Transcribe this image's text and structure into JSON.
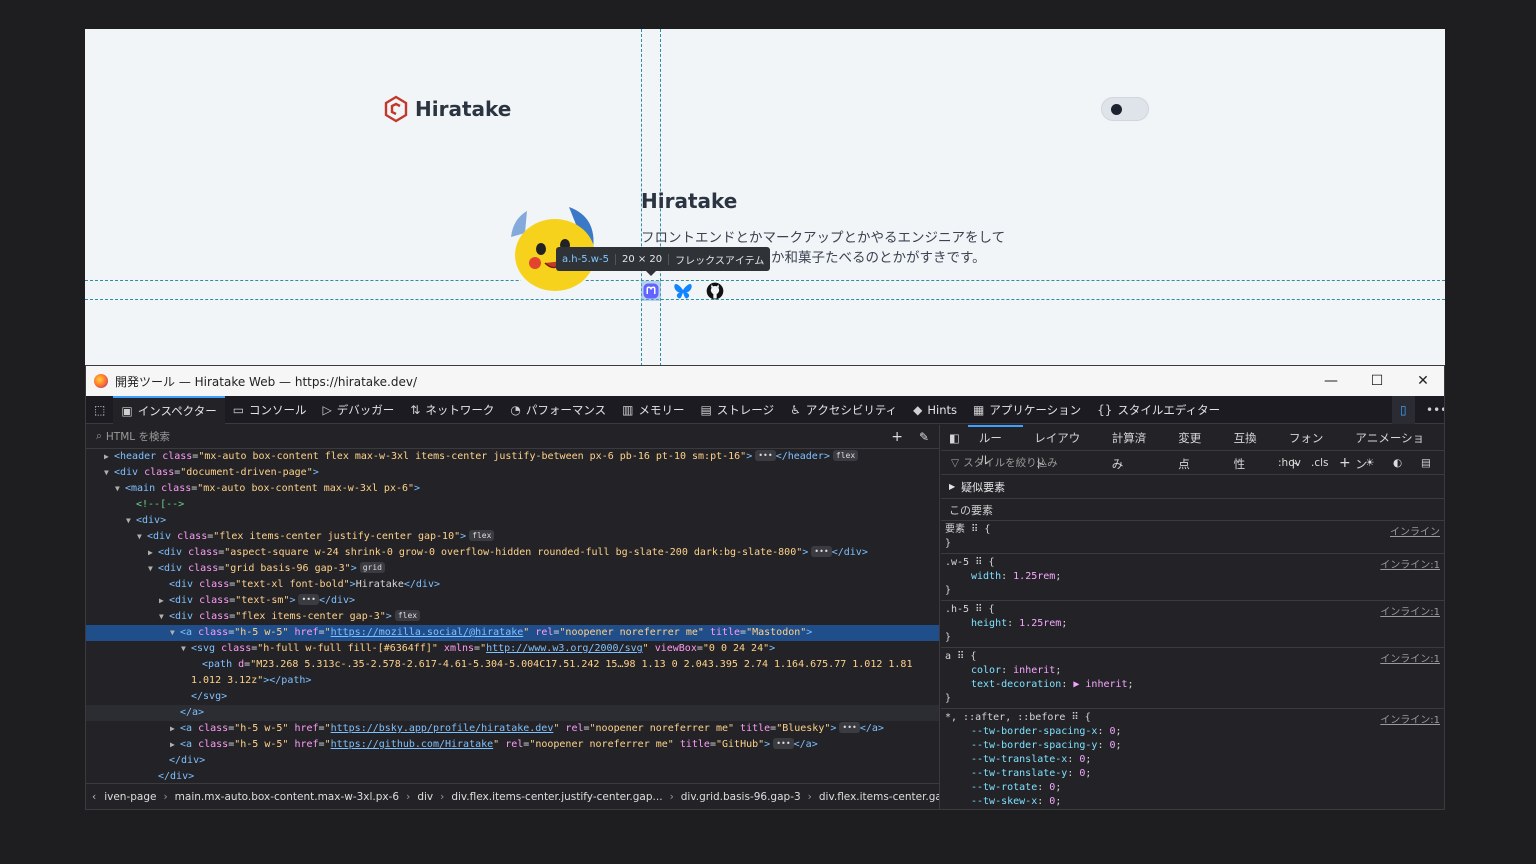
{
  "site": {
    "logo_text": "Hiratake",
    "profile_name": "Hiratake",
    "desc_line1": "フロントエンドとかマークアップとかやるエンジニアをして",
    "desc_line2": "か和菓子たべるのとかがすきです。",
    "mastodon_title": "Mastodon",
    "bluesky_title": "Bluesky",
    "github_title": "GitHub"
  },
  "tooltip": {
    "selector": "a.h-5.w-5",
    "size": "20 × 20",
    "kind": "フレックスアイテム"
  },
  "window": {
    "title": "開発ツール — Hiratake Web — https://hiratake.dev/",
    "minimize": "—",
    "maximize": "☐",
    "close": "✕"
  },
  "tabs": [
    "インスペクター",
    "コンソール",
    "デバッガー",
    "ネットワーク",
    "パフォーマンス",
    "メモリー",
    "ストレージ",
    "アクセシビリティ",
    "Hints",
    "アプリケーション",
    "スタイルエディター"
  ],
  "html_search_placeholder": "HTML を検索",
  "tree": [
    {
      "d": 2,
      "t": "▶",
      "h": "<span class='tg'>&lt;header</span> <span class='at'>class</span>=<span class='av'>\"mx-auto box-content flex max-w-3xl items-center justify-between px-6 pb-16 pt-10 sm:pt-16\"</span><span class='tg'>&gt;</span><span class='badge'>•••</span><span class='tg'>&lt;/header&gt;</span><span class='badge'>flex</span>"
    },
    {
      "d": 2,
      "t": "▼",
      "h": "<span class='tg'>&lt;div</span> <span class='at'>class</span>=<span class='av'>\"document-driven-page\"</span><span class='tg'>&gt;</span>"
    },
    {
      "d": 3,
      "t": "▼",
      "h": "<span class='tg'>&lt;main</span> <span class='at'>class</span>=<span class='av'>\"mx-auto box-content max-w-3xl px-6\"</span><span class='tg'>&gt;</span>"
    },
    {
      "d": 4,
      "t": "",
      "h": "<span class='cm'>&lt;!--[--&gt;</span>"
    },
    {
      "d": 4,
      "t": "▼",
      "h": "<span class='tg'>&lt;div&gt;</span>"
    },
    {
      "d": 5,
      "t": "▼",
      "h": "<span class='tg'>&lt;div</span> <span class='at'>class</span>=<span class='av'>\"flex items-center justify-center gap-10\"</span><span class='tg'>&gt;</span><span class='badge'>flex</span>"
    },
    {
      "d": 6,
      "t": "▶",
      "h": "<span class='tg'>&lt;div</span> <span class='at'>class</span>=<span class='av'>\"aspect-square w-24 shrink-0 grow-0 overflow-hidden rounded-full bg-slate-200 dark:bg-slate-800\"</span><span class='tg'>&gt;</span><span class='badge'>•••</span><span class='tg'>&lt;/div&gt;</span>"
    },
    {
      "d": 6,
      "t": "▼",
      "h": "<span class='tg'>&lt;div</span> <span class='at'>class</span>=<span class='av'>\"grid basis-96 gap-3\"</span><span class='tg'>&gt;</span><span class='badge'>grid</span>"
    },
    {
      "d": 7,
      "t": "",
      "h": "<span class='tg'>&lt;div</span> <span class='at'>class</span>=<span class='av'>\"text-xl font-bold\"</span><span class='tg'>&gt;</span>Hiratake<span class='tg'>&lt;/div&gt;</span>"
    },
    {
      "d": 7,
      "t": "▶",
      "h": "<span class='tg'>&lt;div</span> <span class='at'>class</span>=<span class='av'>\"text-sm\"</span><span class='tg'>&gt;</span><span class='badge'>•••</span><span class='tg'>&lt;/div&gt;</span>"
    },
    {
      "d": 7,
      "t": "▼",
      "h": "<span class='tg'>&lt;div</span> <span class='at'>class</span>=<span class='av'>\"flex items-center gap-3\"</span><span class='tg'>&gt;</span><span class='badge'>flex</span>"
    },
    {
      "d": 8,
      "t": "▼",
      "sel": true,
      "h": "<span class='tg'>&lt;a</span> <span class='at'>class</span>=<span class='av'>\"h-5 w-5\"</span> <span class='at'>href</span>=<span class='av'>\"<span class='lk'>https://mozilla.social/@hiratake</span>\"</span> <span class='at'>rel</span>=<span class='av'>\"noopener noreferrer me\"</span> <span class='at'>title</span>=<span class='av'>\"Mastodon\"</span><span class='tg'>&gt;</span>"
    },
    {
      "d": 9,
      "t": "▼",
      "h": "<span class='tg'>&lt;svg</span> <span class='at'>class</span>=<span class='av'>\"h-full w-full fill-[#6364ff]\"</span> <span class='at'>xmlns</span>=<span class='av'>\"<span class='lk'>http://www.w3.org/2000/svg</span>\"</span> <span class='at'>viewBox</span>=<span class='av'>\"0 0 24 24\"</span><span class='tg'>&gt;</span>"
    },
    {
      "d": 10,
      "t": "",
      "h": "<span class='tg'>&lt;path</span> <span class='at'>d</span>=<span class='av'>\"M23.268 5.313c-.35-2.578-2.617-4.61-5.304-5.004C17.51.242 15…98 1.13 0 2.043.395 2.74 1.164.675.77 1.012 1.81</span>"
    },
    {
      "d": 9,
      "t": "",
      "h": "<span class='av'>1.012 3.12z\"</span><span class='tg'>&gt;&lt;/path&gt;</span>"
    },
    {
      "d": 9,
      "t": "",
      "h": "<span class='tg'>&lt;/svg&gt;</span>"
    },
    {
      "d": 8,
      "t": "",
      "hov": true,
      "h": "<span class='tg'>&lt;/a&gt;</span>"
    },
    {
      "d": 8,
      "t": "▶",
      "h": "<span class='tg'>&lt;a</span> <span class='at'>class</span>=<span class='av'>\"h-5 w-5\"</span> <span class='at'>href</span>=<span class='av'>\"<span class='lk'>https://bsky.app/profile/hiratake.dev</span>\"</span> <span class='at'>rel</span>=<span class='av'>\"noopener noreferrer me\"</span> <span class='at'>title</span>=<span class='av'>\"Bluesky\"</span><span class='tg'>&gt;</span><span class='badge'>•••</span><span class='tg'>&lt;/a&gt;</span>"
    },
    {
      "d": 8,
      "t": "▶",
      "h": "<span class='tg'>&lt;a</span> <span class='at'>class</span>=<span class='av'>\"h-5 w-5\"</span> <span class='at'>href</span>=<span class='av'>\"<span class='lk'>https://github.com/Hiratake</span>\"</span> <span class='at'>rel</span>=<span class='av'>\"noopener noreferrer me\"</span> <span class='at'>title</span>=<span class='av'>\"GitHub\"</span><span class='tg'>&gt;</span><span class='badge'>•••</span><span class='tg'>&lt;/a&gt;</span>"
    },
    {
      "d": 7,
      "t": "",
      "h": "<span class='tg'>&lt;/div&gt;</span>"
    },
    {
      "d": 6,
      "t": "",
      "h": "<span class='tg'>&lt;/div&gt;</span>"
    }
  ],
  "breadcrumbs": [
    "iven-page",
    "main.mx-auto.box-content.max-w-3xl.px-6",
    "div",
    "div.flex.items-center.justify-center.gap...",
    "div.grid.basis-96.gap-3",
    "div.flex.items-center.gap-3"
  ],
  "rule_tabs": [
    "ルール",
    "レイアウト",
    "計算済み",
    "変更点",
    "互換性",
    "フォント",
    "アニメーション"
  ],
  "style_filter_placeholder": "スタイルを絞り込み",
  "hov_label": ":hov",
  "cls_label": ".cls",
  "pseudo_label": "疑似要素",
  "this_element": "この要素",
  "rules": [
    {
      "sel": "要素 ⠿ {",
      "src": "インライン",
      "decls": []
    },
    {
      "sel": ".w-5 ⠿ {",
      "src": "インライン:1",
      "decls": [
        [
          "width",
          "1.25rem"
        ]
      ]
    },
    {
      "sel": ".h-5 ⠿ {",
      "src": "インライン:1",
      "decls": [
        [
          "height",
          "1.25rem"
        ]
      ]
    },
    {
      "sel": "a ⠿ {",
      "src": "インライン:1",
      "decls": [
        [
          "color",
          "inherit"
        ],
        [
          "text-decoration",
          "▶ inherit"
        ]
      ]
    },
    {
      "sel": "*, ::after, ::before ⠿ {",
      "src": "インライン:1",
      "decls": [
        [
          "--tw-border-spacing-x",
          "0"
        ],
        [
          "--tw-border-spacing-y",
          "0"
        ],
        [
          "--tw-translate-x",
          "0"
        ],
        [
          "--tw-translate-y",
          "0"
        ],
        [
          "--tw-rotate",
          "0"
        ],
        [
          "--tw-skew-x",
          "0"
        ]
      ]
    }
  ]
}
